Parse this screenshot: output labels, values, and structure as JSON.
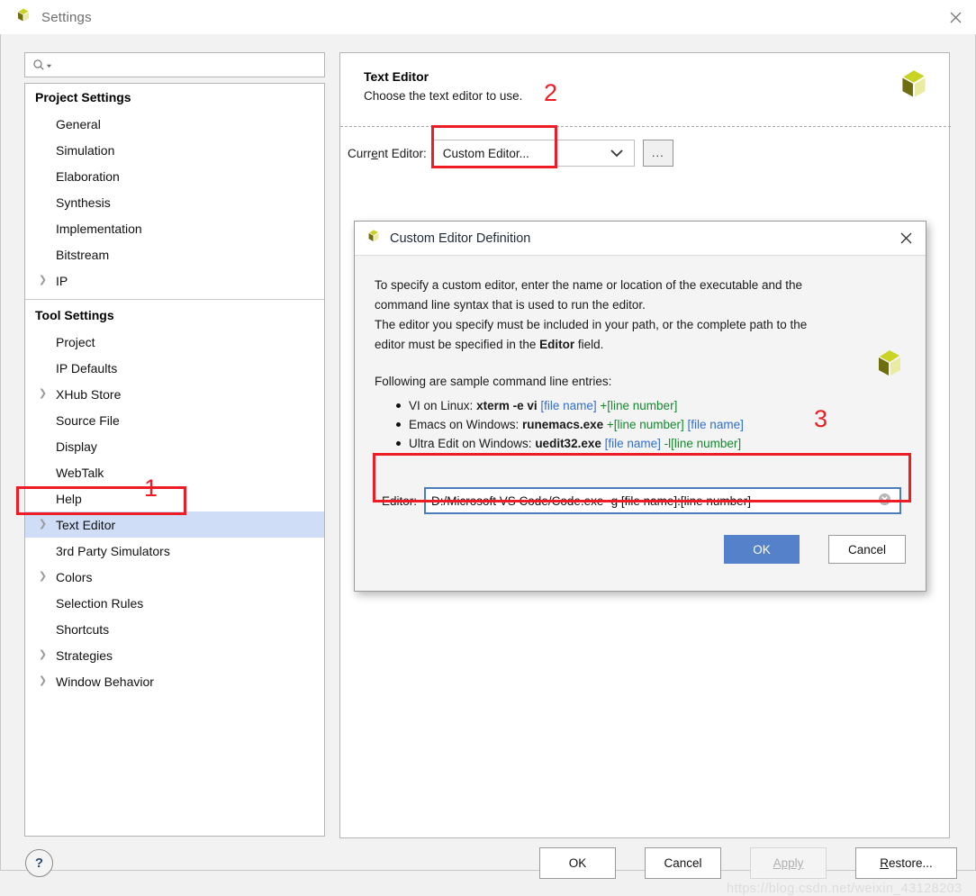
{
  "window": {
    "title": "Settings",
    "close_icon": "close-icon",
    "app_icon": "vivado-logo-icon"
  },
  "search": {
    "value": "",
    "placeholder": "",
    "icon": "search-icon",
    "caret_icon": "chevron-down-icon"
  },
  "sidebar": {
    "groups": [
      {
        "label": "Project Settings",
        "items": [
          {
            "label": "General",
            "expandable": false
          },
          {
            "label": "Simulation",
            "expandable": false
          },
          {
            "label": "Elaboration",
            "expandable": false
          },
          {
            "label": "Synthesis",
            "expandable": false
          },
          {
            "label": "Implementation",
            "expandable": false
          },
          {
            "label": "Bitstream",
            "expandable": false
          },
          {
            "label": "IP",
            "expandable": true
          }
        ]
      },
      {
        "label": "Tool Settings",
        "items": [
          {
            "label": "Project",
            "expandable": false
          },
          {
            "label": "IP Defaults",
            "expandable": false
          },
          {
            "label": "XHub Store",
            "expandable": true
          },
          {
            "label": "Source File",
            "expandable": false
          },
          {
            "label": "Display",
            "expandable": false
          },
          {
            "label": "WebTalk",
            "expandable": false
          },
          {
            "label": "Help",
            "expandable": false
          },
          {
            "label": "Text Editor",
            "expandable": true,
            "selected": true
          },
          {
            "label": "3rd Party Simulators",
            "expandable": false
          },
          {
            "label": "Colors",
            "expandable": true
          },
          {
            "label": "Selection Rules",
            "expandable": false
          },
          {
            "label": "Shortcuts",
            "expandable": false
          },
          {
            "label": "Strategies",
            "expandable": true
          },
          {
            "label": "Window Behavior",
            "expandable": true
          }
        ]
      }
    ]
  },
  "panel": {
    "title": "Text Editor",
    "subtitle": "Choose the text editor to use.",
    "logo_icon": "vivado-logo-icon",
    "current_editor_label": "Current Editor:",
    "current_editor_value": "Custom Editor...",
    "current_editor_options": [
      "Custom Editor..."
    ],
    "browse_button_label": "...",
    "dropdown_icon": "chevron-down-icon"
  },
  "dialog": {
    "title": "Custom Editor Definition",
    "title_icon": "vivado-logo-icon",
    "close_icon": "close-icon",
    "logo_icon": "vivado-logo-icon",
    "paragraph_1": "To specify a custom editor, enter the name or location of the executable and the",
    "paragraph_2": "command line syntax that is used to run the editor.",
    "paragraph_3": "The editor you specify must be included in your path, or the complete path to the",
    "paragraph_4_pre": "editor must be specified in the ",
    "paragraph_4_bold": "Editor",
    "paragraph_4_post": " field.",
    "samples_heading": "Following are sample command line entries:",
    "samples": [
      {
        "prefix": "VI on Linux: ",
        "cmd": "xterm -e vi",
        "arg_blue": " [file name]",
        "arg_green": " +[line number]",
        "arg_blue2": "",
        "order": "blue-green"
      },
      {
        "prefix": "Emacs on Windows: ",
        "cmd": "runemacs.exe",
        "arg_green": " +[line number]",
        "arg_blue": " [file name]",
        "order": "green-blue"
      },
      {
        "prefix": "Ultra Edit on Windows: ",
        "cmd": "uedit32.exe",
        "arg_blue": " [file name]",
        "arg_green": " -l[line number]",
        "order": "blue-green"
      }
    ],
    "editor_label": "Editor:",
    "editor_value": "D:/Microsoft VS Code/Code.exe -g [file name]:[line number]",
    "editor_placeholder": "",
    "clear_icon": "clear-circle-icon",
    "ok_label": "OK",
    "cancel_label": "Cancel"
  },
  "footer": {
    "help_label": "?",
    "ok_label": "OK",
    "cancel_label": "Cancel",
    "apply_label": "Apply",
    "restore_prefix": "R",
    "restore_rest": "estore..."
  },
  "annotations": {
    "one": "1",
    "two": "2",
    "three": "3",
    "color": "#ee1c24"
  },
  "watermark": "https://blog.csdn.net/weixin_43128203"
}
